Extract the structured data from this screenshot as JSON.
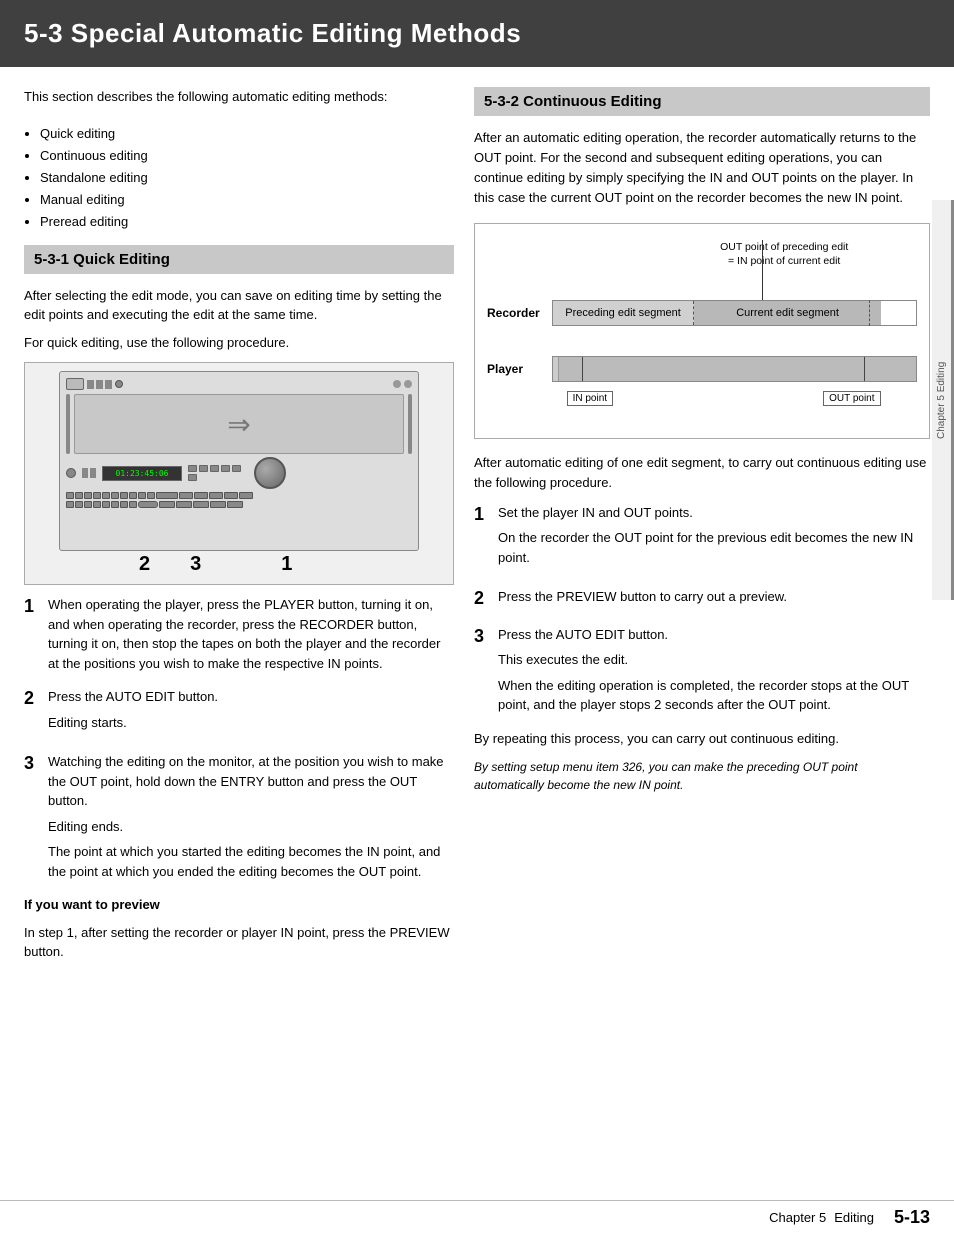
{
  "page": {
    "title": "5-3  Special Automatic Editing Methods"
  },
  "intro": {
    "text": "This section describes the following automatic editing methods:",
    "items": [
      "Quick editing",
      "Continuous editing",
      "Standalone editing",
      "Manual editing",
      "Preread editing"
    ]
  },
  "section531": {
    "header": "5-3-1 Quick Editing",
    "para1": "After selecting the edit mode, you can save on editing time by setting the edit points and executing the edit at the same time.",
    "para2": "For quick editing, use the following procedure.",
    "diagram_numbers": [
      "2",
      "3",
      "1"
    ],
    "step1_num": "1",
    "step1_text": "When operating the player, press the PLAYER button, turning it on, and when operating the recorder, press the RECORDER button, turning it on, then stop the tapes on both the player and the recorder at the positions you wish to make the respective IN points.",
    "step2_num": "2",
    "step2_text": "Press the AUTO EDIT button.",
    "step2_sub": "Editing starts.",
    "step3_num": "3",
    "step3_text": "Watching the editing on the monitor, at the position you wish to make the OUT point, hold down the ENTRY button and press the OUT button.",
    "step3_sub1": "Editing ends.",
    "step3_sub2": "The point at which you started the editing becomes the IN point, and the point at which you ended the editing becomes the OUT point.",
    "preview_heading": "If you want to preview",
    "preview_text": "In step 1, after setting the recorder or player IN point, press the PREVIEW button."
  },
  "section532": {
    "header": "5-3-2 Continuous Editing",
    "para1": "After an automatic editing operation, the recorder automatically returns to the OUT point.  For the second and subsequent editing operations, you can continue editing by simply specifying the IN and OUT points on the player.  In this case the current OUT point on the recorder becomes the new IN point.",
    "diagram": {
      "out_point_note": "OUT point of preceding edit = IN point of current edit",
      "recorder_label": "Recorder",
      "preceding_seg": "Preceding edit segment",
      "current_seg": "Current edit segment",
      "player_label": "Player",
      "in_point": "IN point",
      "out_point": "OUT point"
    },
    "para2": "After automatic editing of one edit segment, to carry out continuous editing use the following procedure.",
    "step1_num": "1",
    "step1_text": "Set the player IN and OUT points.",
    "step1_sub": "On the recorder the OUT point for the previous edit becomes the new IN point.",
    "step2_num": "2",
    "step2_text": "Press the PREVIEW button to carry out a preview.",
    "step3_num": "3",
    "step3_text": "Press the AUTO EDIT button.",
    "step3_sub1": "This executes the edit.",
    "step3_sub2": "When the editing operation is completed, the recorder stops at the OUT point, and the player stops 2 seconds after the OUT point.",
    "para3": "By repeating this process, you can carry out continuous editing.",
    "italic_note": "By setting setup menu item 326, you can make the preceding OUT point automatically become the new IN point."
  },
  "footer": {
    "chapter_label": "Chapter 5",
    "section_label": "Editing",
    "page_number": "5-13"
  },
  "device_display": "01:23:45:06",
  "sidebar_label": "Chapter 5  Editing"
}
